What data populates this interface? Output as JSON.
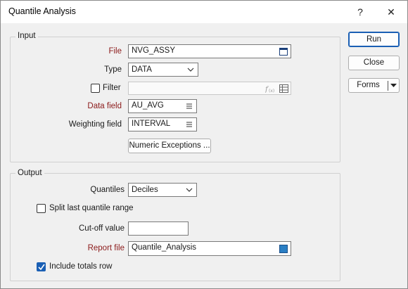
{
  "window": {
    "title": "Quantile Analysis",
    "help": "?",
    "close": "✕"
  },
  "input": {
    "legend": "Input",
    "file": {
      "label": "File",
      "value": "NVG_ASSY"
    },
    "type": {
      "label": "Type",
      "value": "DATA"
    },
    "filter": {
      "label": "Filter",
      "value": "",
      "checked": false
    },
    "data_field": {
      "label": "Data field",
      "value": "AU_AVG"
    },
    "weighting_field": {
      "label": "Weighting field",
      "value": "INTERVAL"
    },
    "numeric_exceptions": "Numeric Exceptions ..."
  },
  "output": {
    "legend": "Output",
    "quantiles": {
      "label": "Quantiles",
      "value": "Deciles"
    },
    "split_last": {
      "label": "Split last quantile range",
      "checked": false
    },
    "cutoff": {
      "label": "Cut-off value",
      "value": ""
    },
    "report_file": {
      "label": "Report file",
      "value": "Quantile_Analysis"
    },
    "include_totals": {
      "label": "Include totals row",
      "checked": true
    }
  },
  "buttons": {
    "run": "Run",
    "close": "Close",
    "forms": "Forms"
  },
  "colors": {
    "accent": "#1a5fb4",
    "required_label": "#8b1a1a"
  }
}
